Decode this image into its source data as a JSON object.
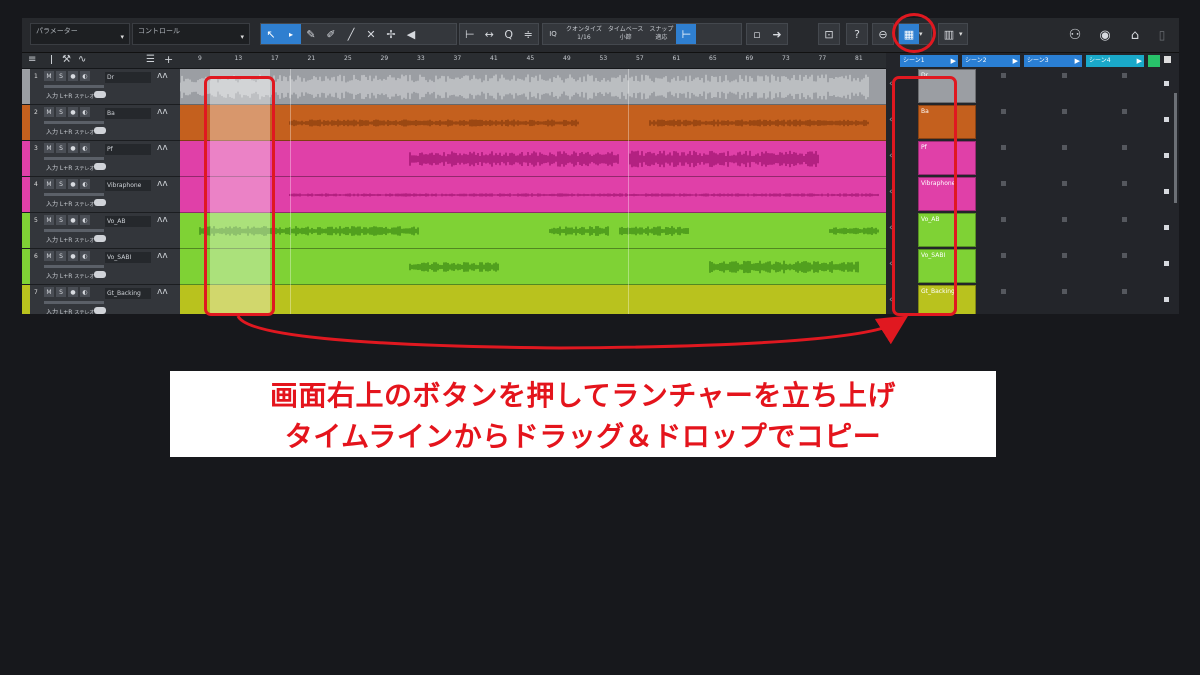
{
  "toolbar": {
    "param_label": "パラメーター",
    "control_label": "コントロール",
    "quantize_label": "クオンタイズ",
    "quantize_value": "1/16",
    "timebase_label": "タイムベース",
    "timebase_value": "小節",
    "snap_label": "スナップ",
    "snap_value": "適応",
    "help_label": "?"
  },
  "track_panel": {
    "input_label": "入力 L+R",
    "stereo_label": "ステレオ"
  },
  "tracks": [
    {
      "num": "1",
      "name": "Dr",
      "color": "#9b9ea3",
      "wave": "#c9cbce"
    },
    {
      "num": "2",
      "name": "Ba",
      "color": "#c4601e",
      "wave": "#8a3d0e"
    },
    {
      "num": "3",
      "name": "Pf",
      "color": "#e040a8",
      "wave": "#a01470"
    },
    {
      "num": "4",
      "name": "Vibraphone",
      "color": "#e040a8",
      "wave": "#a01470"
    },
    {
      "num": "5",
      "name": "Vo_AB",
      "color": "#7fd235",
      "wave": "#3e8a14"
    },
    {
      "num": "6",
      "name": "Vo_SABI",
      "color": "#7fd235",
      "wave": "#3e8a14"
    },
    {
      "num": "7",
      "name": "Gt_Backing",
      "color": "#b9c21e",
      "wave": "#7d8410"
    }
  ],
  "ruler": [
    "9",
    "13",
    "17",
    "21",
    "25",
    "29",
    "33",
    "37",
    "41",
    "45",
    "49",
    "53",
    "57",
    "61",
    "65",
    "69",
    "73",
    "77",
    "81"
  ],
  "scenes": [
    "シーン1",
    "シーン2",
    "シーン3",
    "シーン4"
  ],
  "clips": [
    "Dr",
    "Ba",
    "Pf",
    "Vibraphone",
    "Vo_AB",
    "Vo_SABI",
    "Gt_Backing"
  ],
  "caption": {
    "line1": "画面右上のボタンを押してランチャーを立ち上げ",
    "line2": "タイムラインからドラッグ＆ドロップでコピー"
  },
  "colors": {
    "accent": "#2f7fd0",
    "annotation": "#e01820"
  }
}
